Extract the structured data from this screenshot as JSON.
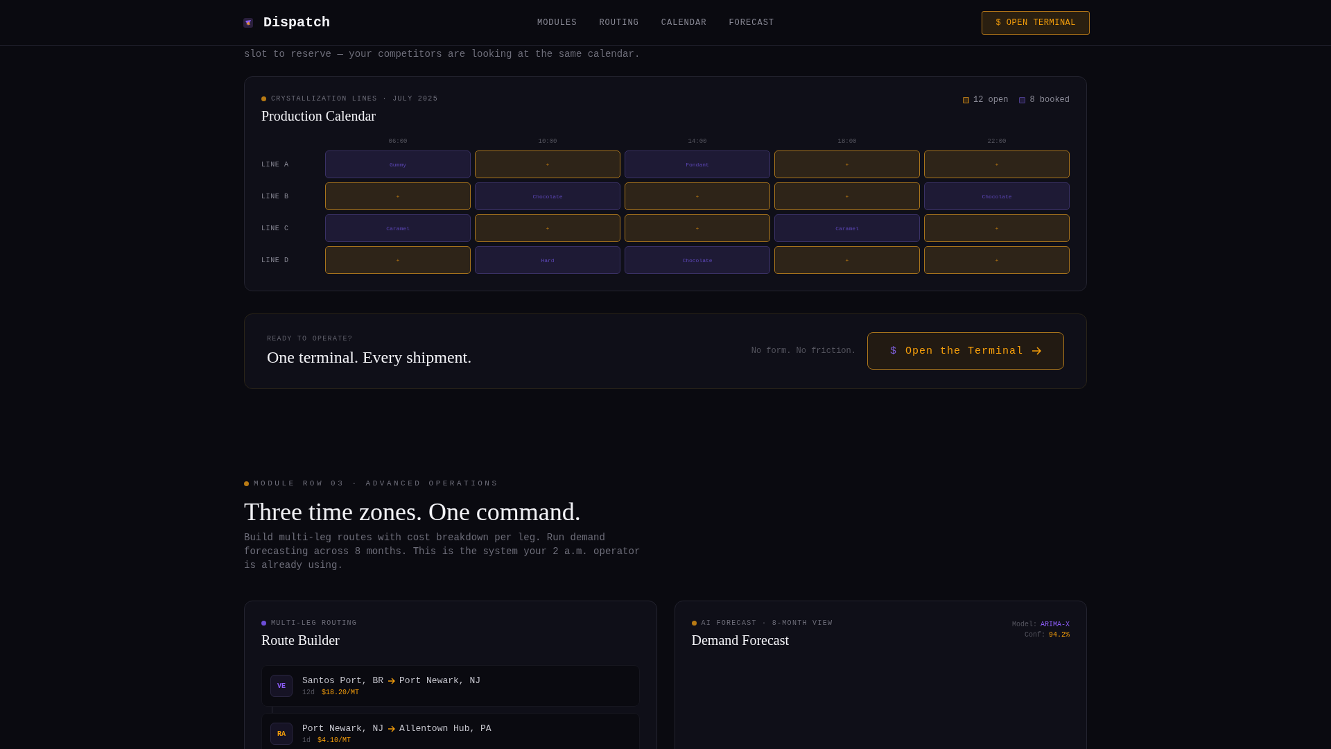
{
  "header": {
    "brand": "Dispatch",
    "nav": [
      {
        "label": "MODULES"
      },
      {
        "label": "ROUTING"
      },
      {
        "label": "CALENDAR"
      },
      {
        "label": "FORECAST"
      }
    ],
    "button": "$ OPEN TERMINAL"
  },
  "intro_tail": "slot to reserve — your competitors are looking at the same calendar.",
  "calendar": {
    "eyebrow": "CRYSTALLIZATION LINES · JULY 2025",
    "title": "Production Calendar",
    "legend": [
      {
        "kind": "open",
        "label": "12 open"
      },
      {
        "kind": "booked",
        "label": "8 booked"
      }
    ],
    "times": [
      "06:00",
      "10:00",
      "14:00",
      "18:00",
      "22:00"
    ],
    "lines": [
      {
        "label": "LINE A",
        "slots": [
          {
            "kind": "booked",
            "label": "Gummy"
          },
          {
            "kind": "open",
            "label": "+"
          },
          {
            "kind": "booked",
            "label": "Fondant"
          },
          {
            "kind": "open",
            "label": "+"
          },
          {
            "kind": "open",
            "label": "+"
          }
        ]
      },
      {
        "label": "LINE B",
        "slots": [
          {
            "kind": "open",
            "label": "+"
          },
          {
            "kind": "booked",
            "label": "Chocolate"
          },
          {
            "kind": "open",
            "label": "+"
          },
          {
            "kind": "open",
            "label": "+"
          },
          {
            "kind": "booked",
            "label": "Chocolate"
          }
        ]
      },
      {
        "label": "LINE C",
        "slots": [
          {
            "kind": "booked",
            "label": "Caramel"
          },
          {
            "kind": "open",
            "label": "+"
          },
          {
            "kind": "open",
            "label": "+"
          },
          {
            "kind": "booked",
            "label": "Caramel"
          },
          {
            "kind": "open",
            "label": "+"
          }
        ]
      },
      {
        "label": "LINE D",
        "slots": [
          {
            "kind": "open",
            "label": "+"
          },
          {
            "kind": "booked",
            "label": "Hard"
          },
          {
            "kind": "booked",
            "label": "Chocolate"
          },
          {
            "kind": "open",
            "label": "+"
          },
          {
            "kind": "open",
            "label": "+"
          }
        ]
      }
    ]
  },
  "cta": {
    "eyebrow": "READY TO OPERATE?",
    "title": "One terminal. Every shipment.",
    "note": "No form. No friction.",
    "button_symbol": "$",
    "button": "Open the Terminal"
  },
  "section": {
    "eyebrow": "MODULE ROW 03 · ADVANCED OPERATIONS",
    "title": "Three time zones. One command.",
    "text": "Build multi-leg routes with cost breakdown per leg. Run demand forecasting across 8 months. This is the system your 2 a.m. operator is already using."
  },
  "route_card": {
    "eyebrow": "MULTI-LEG ROUTING",
    "title": "Route Builder",
    "legs": [
      {
        "badge": "VE",
        "color": "#8b5cf6",
        "from": "Santos Port, BR",
        "to": "Port Newark, NJ",
        "days": "12d",
        "cost": "$18.20/MT"
      },
      {
        "badge": "RA",
        "color": "#f59e0b",
        "from": "Port Newark, NJ",
        "to": "Allentown Hub, PA",
        "days": "1d",
        "cost": "$4.10/MT"
      }
    ]
  },
  "forecast_card": {
    "eyebrow": "AI FORECAST · 8-MONTH VIEW",
    "title": "Demand Forecast",
    "model_label": "Model:",
    "model": "ARIMA-X",
    "conf_label": "Conf:",
    "conf": "94.2%"
  }
}
